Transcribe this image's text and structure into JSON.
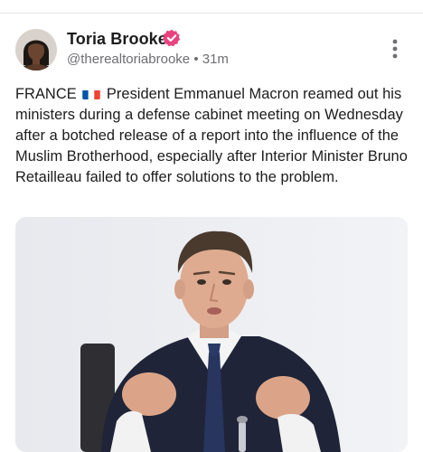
{
  "post": {
    "author": {
      "display_name": "Toria Brooke",
      "handle": "@therealtoriabrooke",
      "separator": "•",
      "time": "31m",
      "verified_icon": "verified-badge-icon",
      "verified_color": "#e8437e"
    },
    "more_icon": "more-vertical-icon",
    "text_prefix": "FRANCE",
    "flag_icon": "france-flag-icon",
    "text_body": "President Emmanuel Macron reamed out his ministers during a defense cabinet meeting on Wednesday after a botched release of a report into the influence of the Muslim Brotherhood, especially after Interior Minister Bruno Retailleau failed to offer solutions to the problem."
  },
  "colors": {
    "text": "#1c1c1e",
    "secondary_text": "#6e6e73",
    "divider": "#e6e6e9",
    "verified": "#e8437e"
  }
}
